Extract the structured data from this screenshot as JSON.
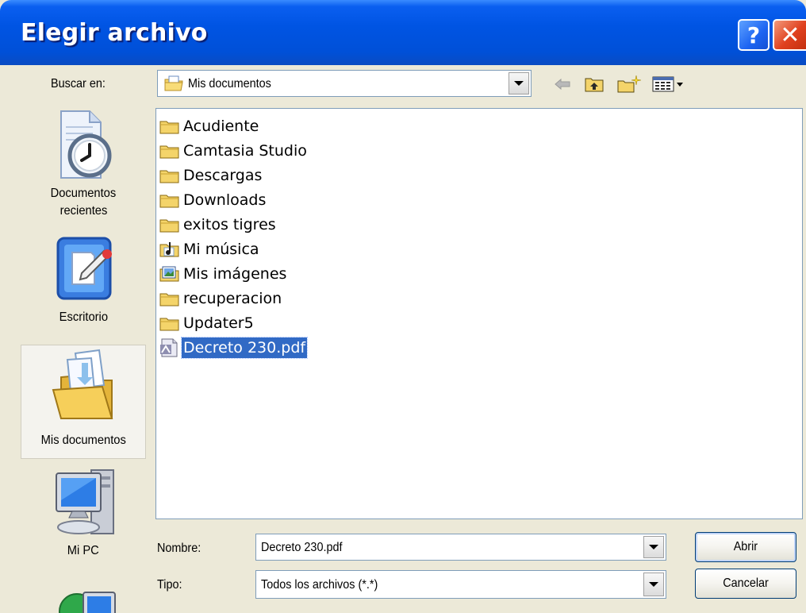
{
  "window": {
    "title": "Elegir archivo",
    "help_glyph": "?",
    "close_glyph": "✕"
  },
  "lookin": {
    "label": "Buscar en:",
    "value": "Mis documentos",
    "toolbar_icons": [
      "back-arrow-icon",
      "up-folder-icon",
      "new-folder-icon",
      "view-menu-icon"
    ]
  },
  "places": [
    {
      "label_line1": "Documentos",
      "label_line2": "recientes",
      "icon": "recent-documents-icon"
    },
    {
      "label_line1": "Escritorio",
      "label_line2": "",
      "icon": "desktop-icon"
    },
    {
      "label_line1": "Mis documentos",
      "label_line2": "",
      "icon": "my-documents-icon",
      "selected": true
    },
    {
      "label_line1": "Mi PC",
      "label_line2": "",
      "icon": "my-computer-icon"
    },
    {
      "label_line1": "",
      "label_line2": "",
      "icon": "network-places-icon"
    }
  ],
  "files": [
    {
      "name": "Acudiente",
      "type": "folder"
    },
    {
      "name": "Camtasia Studio",
      "type": "folder"
    },
    {
      "name": "Descargas",
      "type": "folder"
    },
    {
      "name": "Downloads",
      "type": "folder"
    },
    {
      "name": "exitos tigres",
      "type": "folder"
    },
    {
      "name": "Mi música",
      "type": "music-folder"
    },
    {
      "name": "Mis imágenes",
      "type": "pictures-folder"
    },
    {
      "name": "recuperacion",
      "type": "folder"
    },
    {
      "name": "Updater5",
      "type": "folder"
    },
    {
      "name": "Decreto 230.pdf",
      "type": "pdf",
      "selected": true
    }
  ],
  "filename": {
    "label": "Nombre:",
    "value": "Decreto 230.pdf"
  },
  "filetype": {
    "label": "Tipo:",
    "value": "Todos los archivos (*.*)"
  },
  "buttons": {
    "open": "Abrir",
    "cancel": "Cancelar"
  },
  "colors": {
    "title_bar": "#0054e3",
    "selection": "#316ac5",
    "folder": "#f4d46a"
  }
}
